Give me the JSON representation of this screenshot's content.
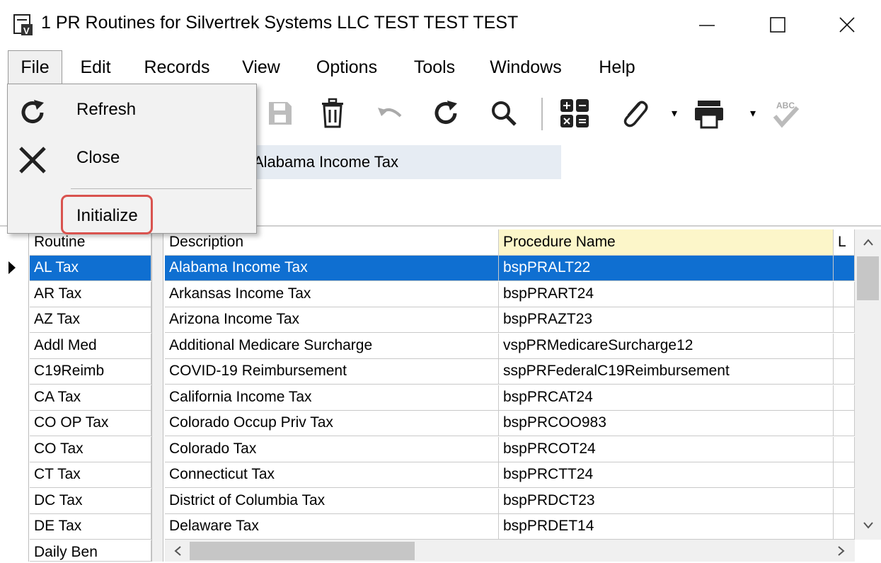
{
  "window": {
    "title": "1 PR Routines for Silvertrek Systems LLC TEST TEST TEST",
    "app_icon": "form-icon",
    "controls": [
      "minimize-icon",
      "maximize-icon",
      "close-icon"
    ]
  },
  "menu": {
    "file": "File",
    "edit": "Edit",
    "records": "Records",
    "view": "View",
    "options": "Options",
    "tools": "Tools",
    "windows": "Windows",
    "help": "Help"
  },
  "file_menu": {
    "refresh": "Refresh",
    "close": "Close",
    "initialize": "Initialize",
    "highlight_color": "#d9534f"
  },
  "toolbar": {
    "icons": [
      "save-icon",
      "delete-icon",
      "undo-icon",
      "refresh-icon",
      "search-icon",
      "calculator-icon",
      "attachment-icon",
      "print-icon",
      "spellcheck-icon"
    ]
  },
  "form": {
    "description_value": "Alabama Income Tax"
  },
  "grid": {
    "headers": {
      "routine": "Routine",
      "description": "Description",
      "procedure": "Procedure Name",
      "extra": "L"
    },
    "selected_color": "#0f6fd1",
    "rows": [
      {
        "routine": "AL Tax",
        "description": "Alabama Income Tax",
        "procedure": "bspPRALT22"
      },
      {
        "routine": "AR Tax",
        "description": "Arkansas Income Tax",
        "procedure": "bspPRART24"
      },
      {
        "routine": "AZ Tax",
        "description": "Arizona Income Tax",
        "procedure": "bspPRAZT23"
      },
      {
        "routine": "Addl Med",
        "description": "Additional Medicare Surcharge",
        "procedure": "vspPRMedicareSurcharge12"
      },
      {
        "routine": "C19Reimb",
        "description": "COVID-19 Reimbursement",
        "procedure": "sspPRFederalC19Reimbursement"
      },
      {
        "routine": "CA Tax",
        "description": "California Income Tax",
        "procedure": "bspPRCAT24"
      },
      {
        "routine": "CO OP Tax",
        "description": "Colorado Occup Priv Tax",
        "procedure": "bspPRCOO983"
      },
      {
        "routine": "CO Tax",
        "description": "Colorado Tax",
        "procedure": "bspPRCOT24"
      },
      {
        "routine": "CT Tax",
        "description": "Connecticut Tax",
        "procedure": "bspPRCTT24"
      },
      {
        "routine": "DC Tax",
        "description": "District of Columbia Tax",
        "procedure": "bspPRDCT23"
      },
      {
        "routine": "DE Tax",
        "description": "Delaware Tax",
        "procedure": "bspPRDET14"
      },
      {
        "routine": "Daily Ben",
        "description": "",
        "procedure": ""
      }
    ]
  }
}
